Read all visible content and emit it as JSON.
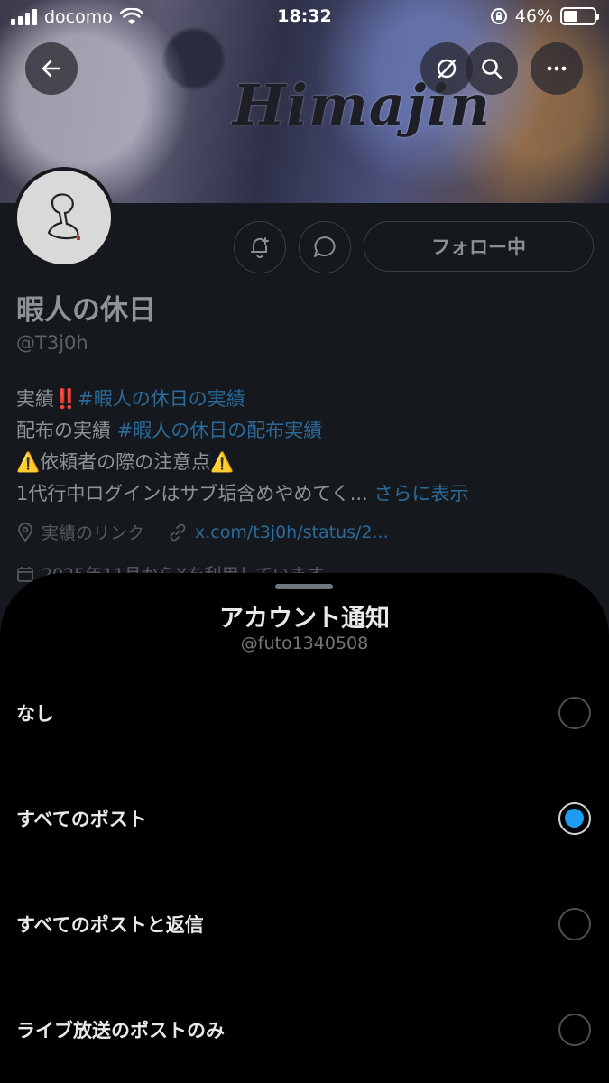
{
  "status_bar": {
    "carrier": "docomo",
    "time": "18:32",
    "battery": "46%",
    "battery_level": 0.46
  },
  "profile": {
    "banner_text": "Himajin",
    "name": "暇人の休日",
    "handle": "@T3j0h",
    "follow_label": "フォロー中",
    "bio": {
      "line1_prefix": "実績",
      "line1_emoji": "‼️",
      "line1_tag": "#暇人の休日の実績",
      "line2_prefix": "配布の実績 ",
      "line2_tag": "#暇人の休日の配布実績",
      "line3_warn_left": "⚠️",
      "line3_text": "依頼者の際の注意点",
      "line3_warn_right": "⚠️",
      "line4_text": "1代行中ログインはサブ垢含めやめてく...",
      "more": "さらに表示"
    },
    "location": "実績のリンク",
    "link": "x.com/t3j0h/status/2...",
    "joined": "2025年11月からXを利用しています"
  },
  "sheet": {
    "title": "アカウント通知",
    "subtitle": "@futo1340508",
    "options": [
      {
        "label": "なし",
        "selected": false
      },
      {
        "label": "すべてのポスト",
        "selected": true
      },
      {
        "label": "すべてのポストと返信",
        "selected": false
      },
      {
        "label": "ライブ放送のポストのみ",
        "selected": false
      }
    ]
  },
  "colors": {
    "accent": "#1d9bf0",
    "sheet_bg": "#000000",
    "profile_bg": "#15181c"
  }
}
